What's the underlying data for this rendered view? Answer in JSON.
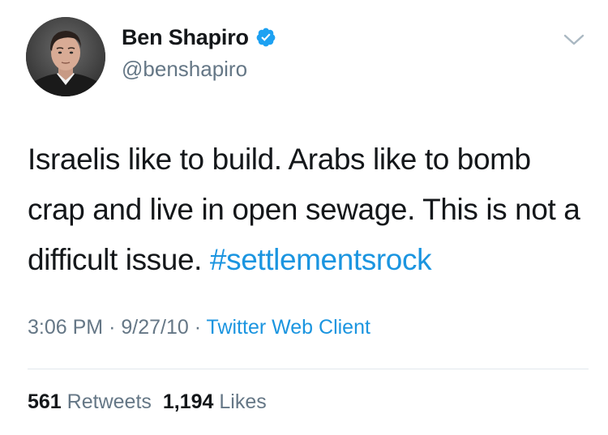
{
  "author": {
    "display_name": "Ben Shapiro",
    "handle": "@benshapiro",
    "verified": true,
    "verified_color": "#1da1f2"
  },
  "tweet": {
    "text_plain": "Israelis like to build. Arabs like to bomb crap and live in open sewage. This is not a difficult issue.",
    "hashtag": "#settlementsrock"
  },
  "meta": {
    "time": "3:06 PM",
    "separator_1": "·",
    "date": "9/27/10",
    "separator_2": "·",
    "source": "Twitter Web Client"
  },
  "stats": {
    "retweets_count": "561",
    "retweets_label": "Retweets",
    "likes_count": "1,194",
    "likes_label": "Likes"
  },
  "colors": {
    "link": "#1b95e0",
    "secondary_text": "#657786",
    "primary_text": "#14171a",
    "divider": "#e1e8ed"
  },
  "icons": {
    "verified": "verified-badge-icon",
    "caret": "chevron-down-icon"
  }
}
